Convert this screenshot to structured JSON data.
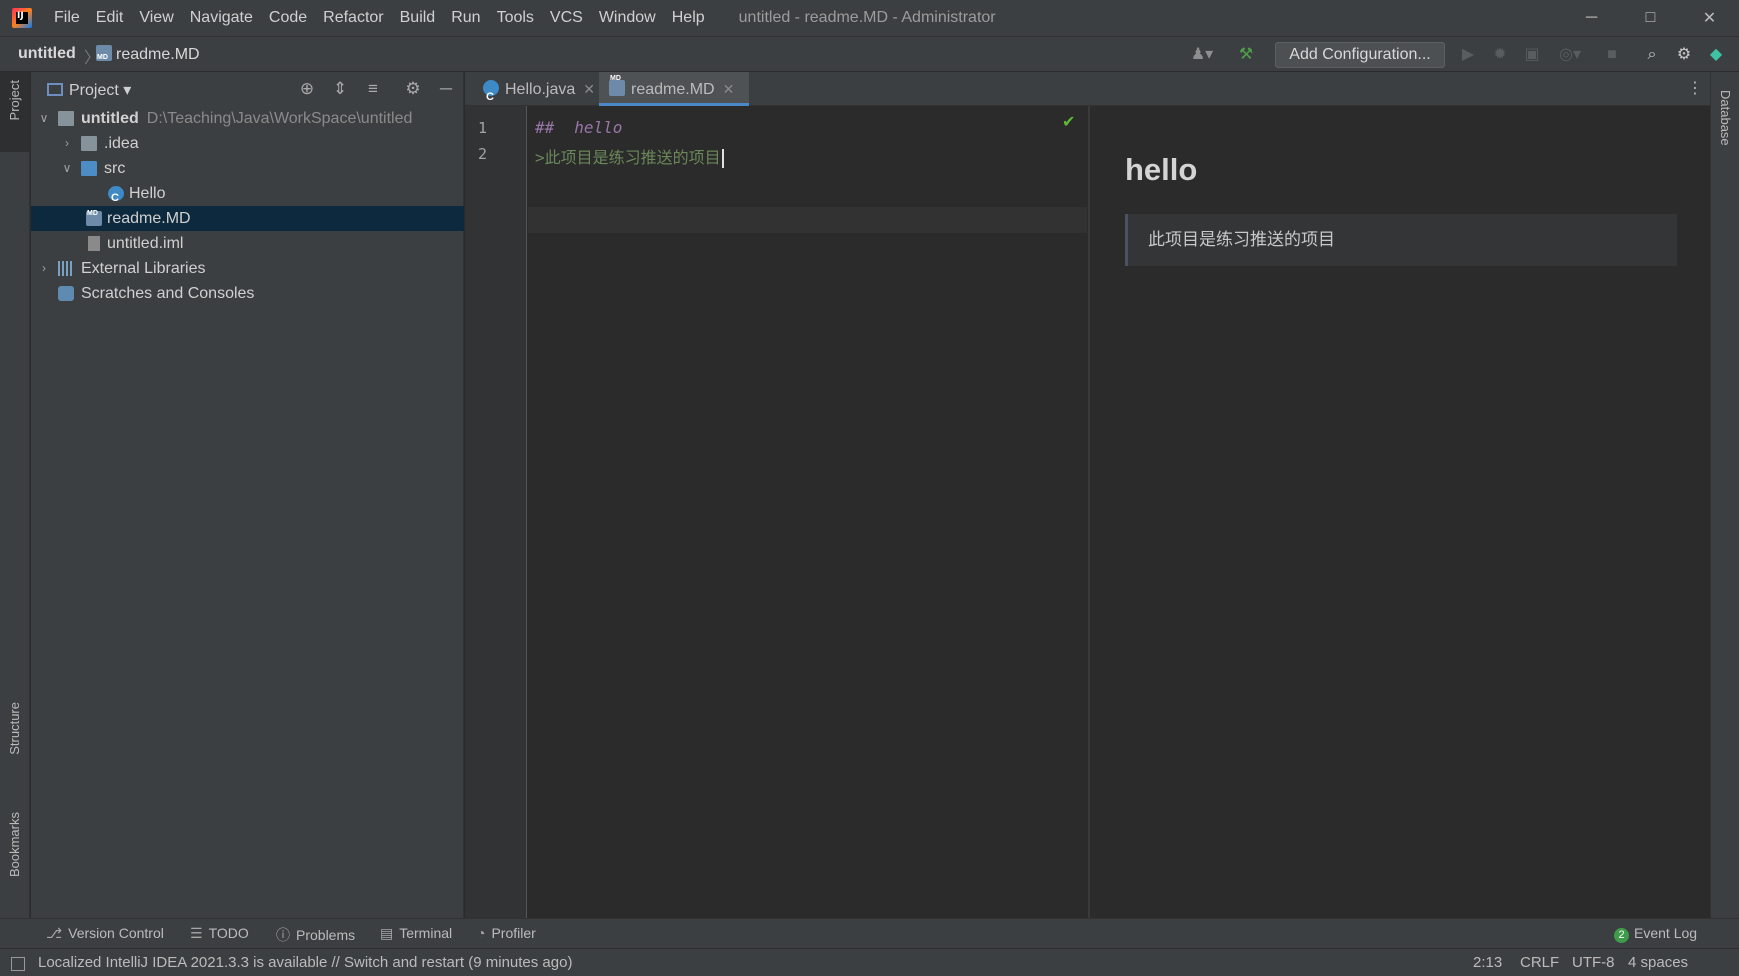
{
  "titlebar": {
    "menu": [
      "File",
      "Edit",
      "View",
      "Navigate",
      "Code",
      "Refactor",
      "Build",
      "Run",
      "Tools",
      "VCS",
      "Window",
      "Help"
    ],
    "window_title": "untitled - readme.MD - Administrator"
  },
  "navbar": {
    "root": "untitled",
    "file": "readme.MD",
    "add_configuration": "Add Configuration..."
  },
  "left_strip": {
    "project": "Project",
    "structure": "Structure",
    "bookmarks": "Bookmarks"
  },
  "right_strip": {
    "database": "Database"
  },
  "project_panel": {
    "title": "Project",
    "tree": {
      "root_name": "untitled",
      "root_path": "D:\\Teaching\\Java\\WorkSpace\\untitled",
      "idea": ".idea",
      "src": "src",
      "hello": "Hello",
      "readme": "readme.MD",
      "iml": "untitled.iml",
      "ext_libs": "External Libraries",
      "scratches": "Scratches and Consoles"
    }
  },
  "editor": {
    "tabs": [
      "Hello.java",
      "readme.MD"
    ],
    "line_numbers": [
      "1",
      "2"
    ],
    "line1_marker": "##",
    "line1_text": "hello",
    "line2_text": ">此项目是练习推送的项目"
  },
  "preview": {
    "heading": "hello",
    "blockquote": "此项目是练习推送的项目"
  },
  "bottom_tools": {
    "version_control": "Version Control",
    "todo": "TODO",
    "problems": "Problems",
    "terminal": "Terminal",
    "profiler": "Profiler",
    "event_log_count": "2",
    "event_log": "Event Log"
  },
  "status": {
    "message": "Localized IntelliJ IDEA 2021.3.3 is available // Switch and restart (9 minutes ago)",
    "position": "2:13",
    "line_sep": "CRLF",
    "encoding": "UTF-8",
    "indent": "4 spaces"
  }
}
